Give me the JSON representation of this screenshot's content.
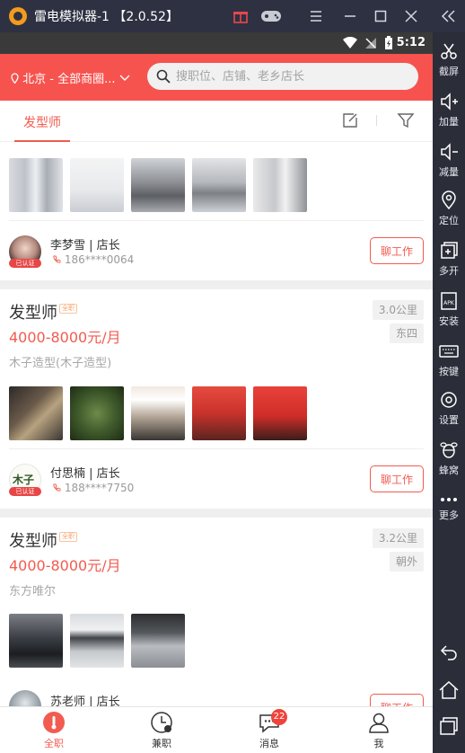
{
  "emulator": {
    "title": "雷电模拟器-1 【2.0.52】",
    "side": [
      {
        "name": "screenshot",
        "label": "截屏"
      },
      {
        "name": "volume-up",
        "label": "加量"
      },
      {
        "name": "volume-down",
        "label": "减量"
      },
      {
        "name": "location",
        "label": "定位"
      },
      {
        "name": "multi-instance",
        "label": "多开"
      },
      {
        "name": "install",
        "label": "安装"
      },
      {
        "name": "keymap",
        "label": "按键"
      },
      {
        "name": "settings",
        "label": "设置"
      },
      {
        "name": "hive",
        "label": "蜂窝"
      },
      {
        "name": "more",
        "label": "更多"
      }
    ]
  },
  "statusbar": {
    "time": "5:12"
  },
  "header": {
    "city": "北京 - 全部商圈...",
    "search_placeholder": "搜职位、店铺、老乡店长"
  },
  "tabs": {
    "active": "发型师"
  },
  "cards": [
    {
      "manager_name": "李梦雪 | 店长",
      "phone": "186****0064",
      "verified": "已认证",
      "chat": "聊工作"
    },
    {
      "title": "发型师",
      "tag": "全职",
      "salary": "4000-8000元/月",
      "company": "木子造型(木子造型)",
      "distance": "3.0公里",
      "area": "东四",
      "manager_name": "付思楠 | 店长",
      "phone": "188****7750",
      "verified": "已认证",
      "avatar_text": "木子",
      "chat": "聊工作"
    },
    {
      "title": "发型师",
      "tag": "全职",
      "salary": "4000-8000元/月",
      "company": "东方唯尔",
      "distance": "3.2公里",
      "area": "朝外",
      "manager_name": "苏老师 | 店长",
      "chat": "聊工作"
    }
  ],
  "bottomnav": {
    "items": [
      {
        "label": "全职"
      },
      {
        "label": "兼职"
      },
      {
        "label": "消息"
      },
      {
        "label": "我"
      }
    ],
    "message_count": "22"
  }
}
